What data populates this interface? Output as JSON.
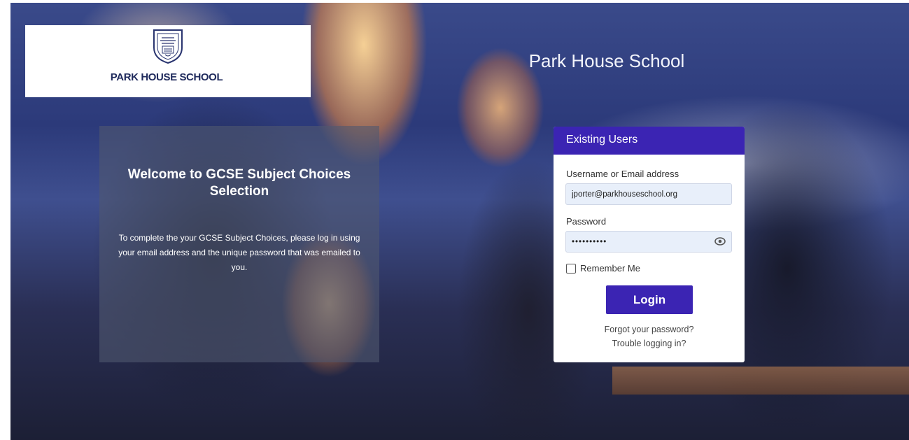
{
  "logo": {
    "school_name": "PARK HOUSE SCHOOL",
    "crest_icon": "school-crest-icon"
  },
  "header": {
    "title": "Park House School"
  },
  "welcome": {
    "title": "Welcome to GCSE Subject Choices Selection",
    "text": "To complete the your GCSE Subject Choices, please log in using your email address and the unique password that was emailed to you."
  },
  "login": {
    "header": "Existing Users",
    "username_label": "Username or Email address",
    "username_value": "jporter@parkhouseschool.org",
    "password_label": "Password",
    "password_value": "••••••••••",
    "remember_label": "Remember Me",
    "button_label": "Login",
    "forgot_link": "Forgot your password?",
    "trouble_link": "Trouble logging in?"
  },
  "colors": {
    "accent": "#3b24b3",
    "school_name": "#1f2a5c",
    "input_bg": "#e8effa"
  }
}
